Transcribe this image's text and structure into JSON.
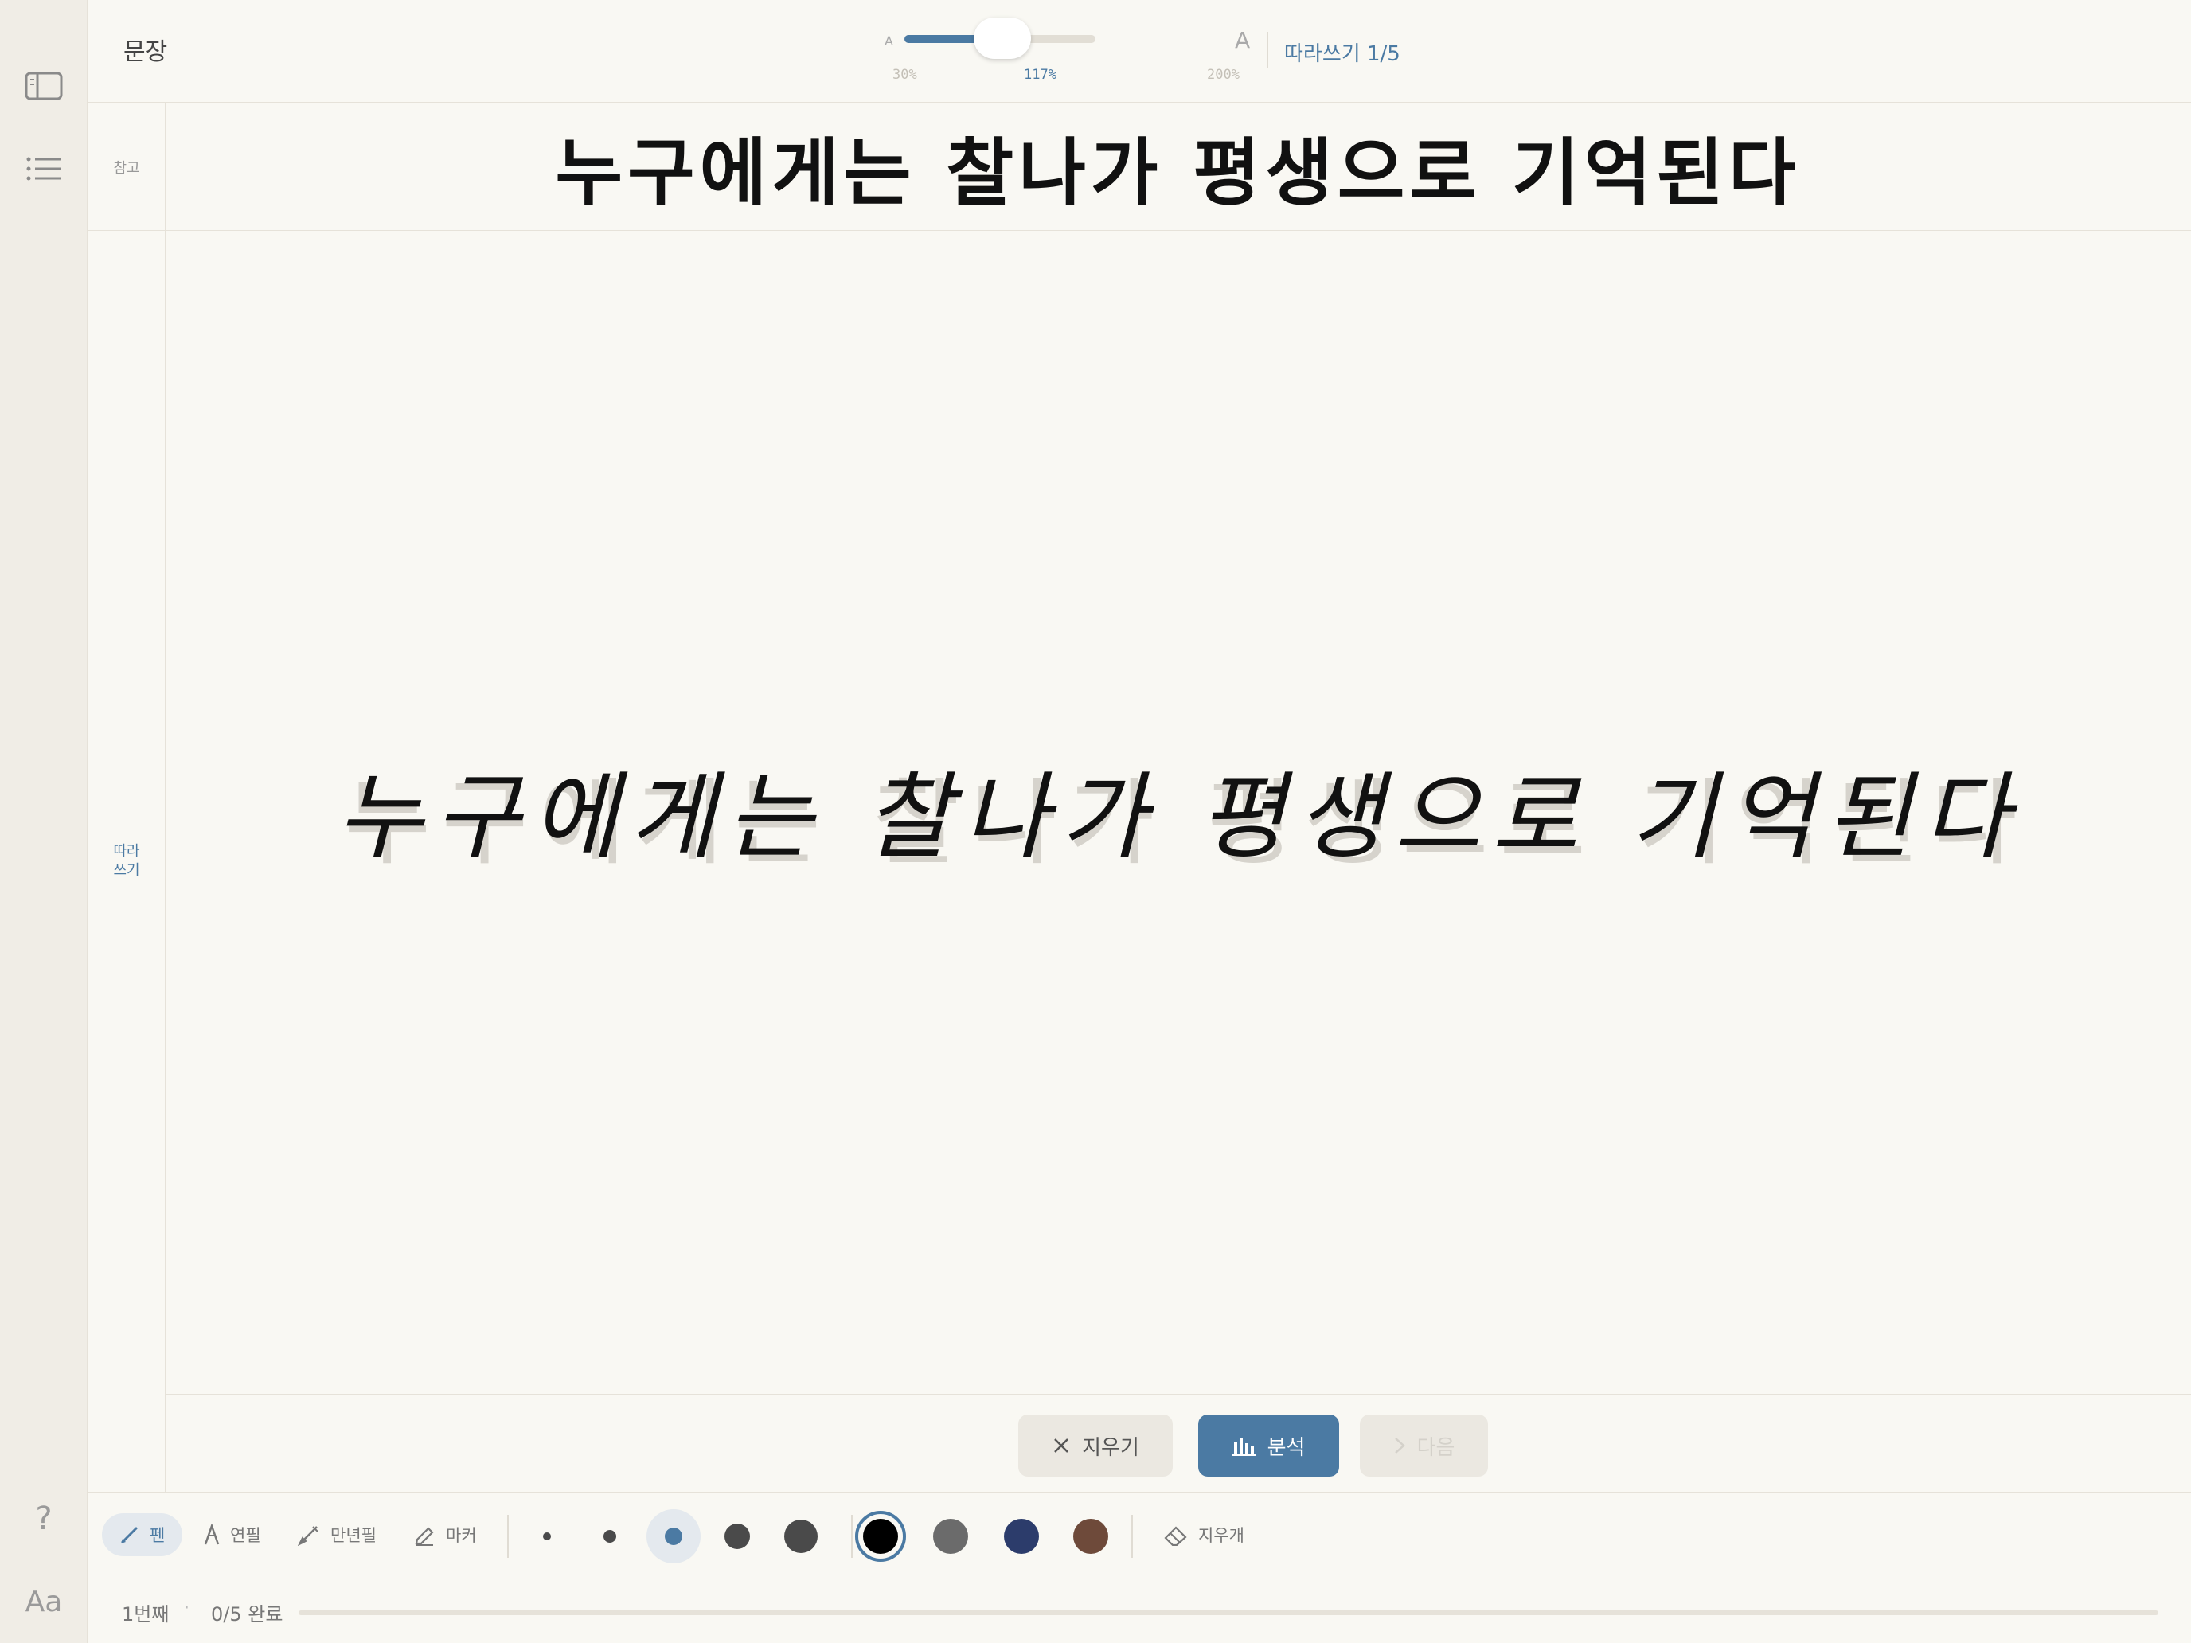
{
  "header": {
    "mode_label": "문장",
    "zoom": {
      "small_a": "A",
      "big_a": "A",
      "min_label": "30%",
      "current_label": "117%",
      "max_label": "200%",
      "value_percent": 117,
      "min_percent": 30,
      "max_percent": 200
    },
    "trace_count": "따라쓰기 1/5"
  },
  "reference": {
    "label": "참고",
    "text": "누구에게는 찰나가 평생으로 기억된다"
  },
  "trace": {
    "label_line1": "따라",
    "label_line2": "쓰기",
    "guide_text": "누구에게는 찰나가 평생으로 기억된다",
    "written_text": "누구에게는 찰나가 평생으로 기억된다"
  },
  "actions": {
    "clear_label": "지우기",
    "analyze_label": "분석",
    "next_label": "다음"
  },
  "tools": {
    "pen": "펜",
    "pencil": "연필",
    "fountain_pen": "만년필",
    "marker": "마커",
    "eraser": "지우개",
    "active_tool": "pen"
  },
  "stroke_sizes": {
    "options": [
      1,
      2,
      3,
      4,
      5
    ],
    "selected": 3
  },
  "colors": {
    "swatches": [
      "#000000",
      "#6b6b6b",
      "#2c3c6b",
      "#6e4a3a"
    ],
    "selected": "#000000",
    "accent": "#4b7aa3"
  },
  "rail": {
    "help": "?",
    "font": "Aa"
  },
  "status": {
    "item_index": "1번째",
    "separator": "·",
    "completed": "0/5 완료",
    "progress_fraction": 0.0
  }
}
